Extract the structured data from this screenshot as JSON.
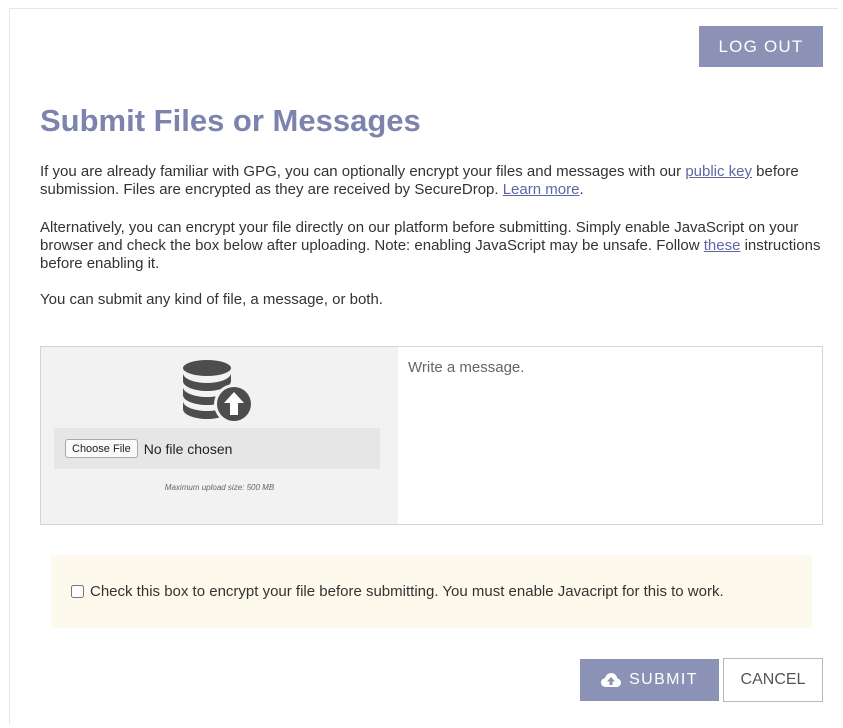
{
  "header": {
    "logout_label": "LOG OUT"
  },
  "page": {
    "title": "Submit Files or Messages",
    "intro": {
      "text_before_key": "If you are already familiar with GPG, you can optionally encrypt your files and messages with our ",
      "public_key_link": "public key",
      "text_after_key": " before submission. Files are encrypted as they are received by SecureDrop. ",
      "learn_more_link": "Learn more",
      "text_end": "."
    },
    "alternative": {
      "text_before_link": "Alternatively, you can encrypt your file directly on our platform before submitting. Simply enable JavaScript on your browser and check the box below after uploading. Note: enabling JavaScript may be unsafe. Follow ",
      "these_link": "these",
      "text_after_link": " instructions before enabling it."
    },
    "submit_note": "You can submit any kind of file, a message, or both."
  },
  "upload": {
    "icon": "database-upload-icon",
    "choose_file_label": "Choose File",
    "no_file_text": "No file chosen",
    "max_size_text": "Maximum upload size: 500 MB"
  },
  "message": {
    "placeholder": "Write a message.",
    "value": ""
  },
  "encrypt": {
    "checked": false,
    "label": "Check this box to encrypt your file before submitting. You must enable Javacript for this to work."
  },
  "actions": {
    "submit_icon": "cloud-upload-icon",
    "submit_label": "SUBMIT",
    "cancel_label": "CANCEL"
  },
  "colors": {
    "accent": "#8b92b5",
    "title": "#7c83ad",
    "link": "#5f67a3",
    "notice_background": "#fdf9ec"
  }
}
